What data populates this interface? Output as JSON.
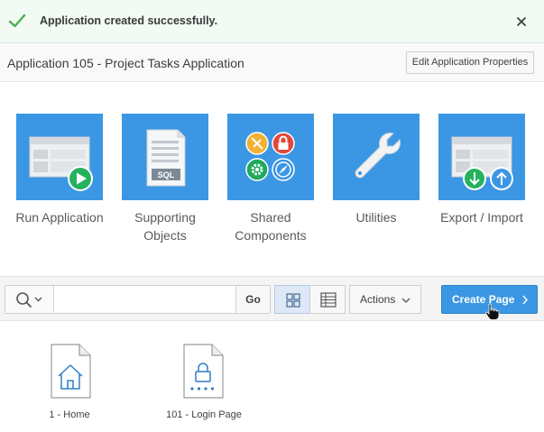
{
  "banner": {
    "message": "Application created successfully.",
    "icons": {
      "status": "check-icon",
      "close": "close-icon"
    },
    "accent_color": "#4caf50"
  },
  "header": {
    "title": "Application 105 - Project Tasks Application",
    "edit_button_label": "Edit Application Properties"
  },
  "tiles": [
    {
      "label": "Run Application",
      "icon": "run-application-icon"
    },
    {
      "label_line1": "Supporting",
      "label_line2": "Objects",
      "icon": "supporting-objects-icon",
      "icon_text": "SQL"
    },
    {
      "label_line1": "Shared",
      "label_line2": "Components",
      "icon": "shared-components-icon"
    },
    {
      "label": "Utilities",
      "icon": "wrench-icon"
    },
    {
      "label": "Export / Import",
      "icon": "export-import-icon"
    }
  ],
  "toolbar": {
    "search_placeholder": "",
    "search_value": "",
    "go_label": "Go",
    "actions_label": "Actions",
    "create_page_label": "Create Page",
    "active_view": "icons"
  },
  "pages": [
    {
      "label": "1 - Home",
      "icon": "home-page-icon"
    },
    {
      "label": "101 - Login Page",
      "icon": "login-page-icon"
    }
  ],
  "colors": {
    "tile_blue": "#3b97e3",
    "banner_bg": "#f1faf3",
    "icon_blue": "#2f7fc4"
  }
}
